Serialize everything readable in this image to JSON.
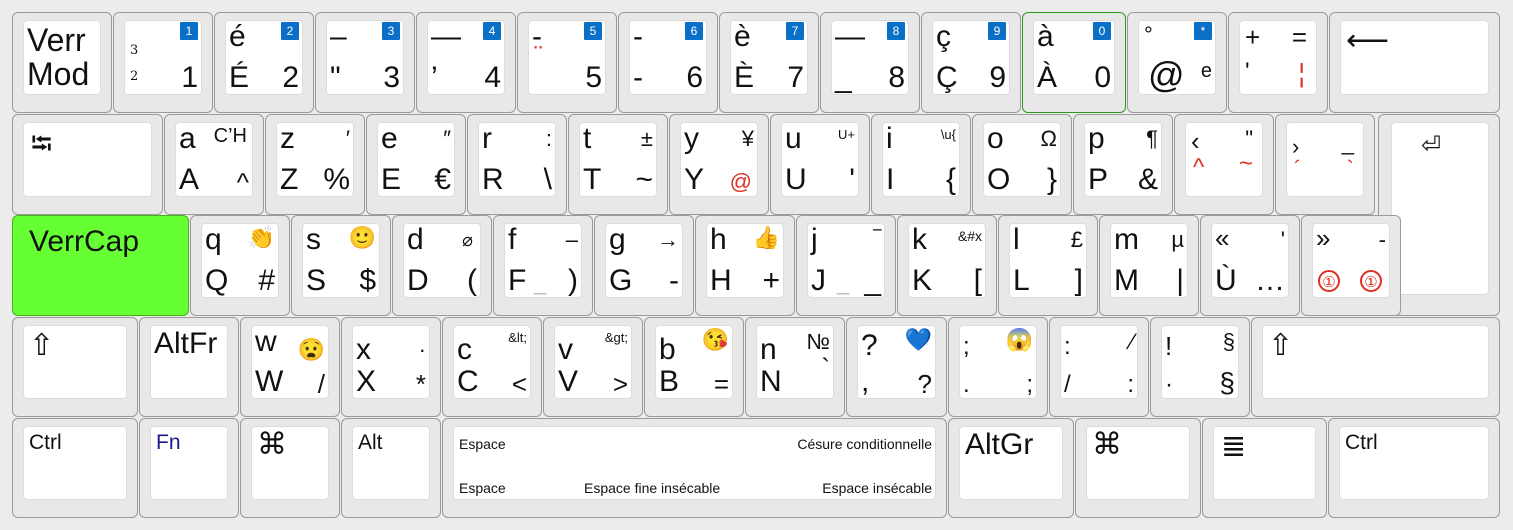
{
  "title": "",
  "row1": [
    {
      "id": "verrmod",
      "top": "Verr",
      "bottom": "Mod"
    },
    {
      "id": "k1",
      "badge": "1",
      "ul": "3",
      "ll": "2",
      "lr": "1"
    },
    {
      "id": "k2",
      "badge": "2",
      "ul": "é",
      "ll": "É",
      "lr": "2"
    },
    {
      "id": "k3",
      "badge": "3",
      "ul": "–",
      "ll": "\"",
      "lr": "3"
    },
    {
      "id": "k4",
      "badge": "4",
      "ul": "—",
      "ll": "’",
      "lr": "4"
    },
    {
      "id": "k5",
      "badge": "5",
      "ul": "-",
      "ll": "̈",
      "lr": "5"
    },
    {
      "id": "k6",
      "badge": "6",
      "ul": "-",
      "ll": "-",
      "lr": "6"
    },
    {
      "id": "k7",
      "badge": "7",
      "ul": "è",
      "ll": "È",
      "lr": "7"
    },
    {
      "id": "k8",
      "badge": "8",
      "ul": "—",
      "ll": "_",
      "lr": "8"
    },
    {
      "id": "k9",
      "badge": "9",
      "ul": "ç",
      "ll": "Ç",
      "lr": "9"
    },
    {
      "id": "k0",
      "badge": "0",
      "ul": "à",
      "ll": "À",
      "lr": "0"
    },
    {
      "id": "kdeg",
      "badge": "*",
      "ul": "°",
      "ll": "@",
      "lr": "e"
    },
    {
      "id": "kplus",
      "ul": "+",
      "ur": "=",
      "ll": "'",
      "lr": "¦"
    },
    {
      "id": "backspace",
      "symbol": "⟵"
    }
  ],
  "row2": [
    {
      "id": "tab",
      "symbol": "⭾"
    },
    {
      "id": "kA",
      "ul": "a",
      "ur": "C’H",
      "ll": "A",
      "lr": "^"
    },
    {
      "id": "kZ",
      "ul": "z",
      "ur": "′",
      "ll": "Z",
      "lr": "%"
    },
    {
      "id": "kE",
      "ul": "e",
      "ur": "″",
      "ll": "E",
      "lr": "€"
    },
    {
      "id": "kR",
      "ul": "r",
      "ur": ":",
      "ll": "R",
      "lr": "\\"
    },
    {
      "id": "kT",
      "ul": "t",
      "ur": "±",
      "ll": "T",
      "lr": "~"
    },
    {
      "id": "kY",
      "ul": "y",
      "ur": "¥",
      "ll": "Y",
      "lr": "@"
    },
    {
      "id": "kU",
      "ul": "u",
      "ur": "U+",
      "ll": "U",
      "lr": "'"
    },
    {
      "id": "kI",
      "ul": "i",
      "ur": "\\u{",
      "ll": "I",
      "lr": "{"
    },
    {
      "id": "kO",
      "ul": "o",
      "ur": "Ω",
      "ll": "O",
      "lr": "}"
    },
    {
      "id": "kP",
      "ul": "p",
      "ur": "¶",
      "ll": "P",
      "lr": "&"
    },
    {
      "id": "kLang",
      "ul": "‹",
      "ur": "\"",
      "ll": "^",
      "lr": "~"
    },
    {
      "id": "kRang",
      "ul": "›",
      "ur": "_",
      "ll": "´",
      "lr": "`"
    },
    {
      "id": "enter",
      "symbol": "⏎"
    }
  ],
  "row3": [
    {
      "id": "verrcap",
      "label": "VerrCap"
    },
    {
      "id": "kQ",
      "ul": "q",
      "ur": "👏",
      "ll": "Q",
      "lr": "#"
    },
    {
      "id": "kS",
      "ul": "s",
      "ur": "🙂",
      "ll": "S",
      "lr": "$"
    },
    {
      "id": "kD",
      "ul": "d",
      "ur": "⌀",
      "ll": "D",
      "lr": "("
    },
    {
      "id": "kF",
      "ul": "f",
      "ur": "–",
      "ll": "F",
      "lr": ")"
    },
    {
      "id": "kG",
      "ul": "g",
      "ur": "→",
      "ll": "G",
      "lr": "-"
    },
    {
      "id": "kH",
      "ul": "h",
      "ur": "👍",
      "ll": "H",
      "lr": "+"
    },
    {
      "id": "kJ",
      "ul": "j",
      "ur": "‾",
      "ll": "J",
      "lr": "_"
    },
    {
      "id": "kK",
      "ul": "k",
      "ur": "&#x",
      "ll": "K",
      "lr": "["
    },
    {
      "id": "kL",
      "ul": "l",
      "ur": "£",
      "ll": "L",
      "lr": "]"
    },
    {
      "id": "kM",
      "ul": "m",
      "ur": "µ",
      "ll": "M",
      "lr": "|"
    },
    {
      "id": "kGuil",
      "ul": "«",
      "ur": "'",
      "ll": "Ù",
      "lr": "…"
    },
    {
      "id": "kGuir",
      "ul": "»",
      "ur": "-",
      "ll": "①",
      "lr": "①"
    }
  ],
  "row4": [
    {
      "id": "lshift",
      "symbol": "⇧"
    },
    {
      "id": "altfr",
      "label": "AltFr"
    },
    {
      "id": "kW",
      "ul": "w",
      "ur": "😧",
      "ll": "W",
      "lr": "/"
    },
    {
      "id": "kX",
      "ul": "x",
      "ur": "·",
      "ll": "X",
      "lr": "*"
    },
    {
      "id": "kC",
      "ul": "c",
      "ur": "&lt;",
      "ll": "C",
      "lr": "<"
    },
    {
      "id": "kV",
      "ul": "v",
      "ur": "&gt;",
      "ll": "V",
      "lr": ">"
    },
    {
      "id": "kB",
      "ul": "b",
      "ur": "😘",
      "ll": "B",
      "lr": "="
    },
    {
      "id": "kN",
      "ul": "n",
      "ur": "№",
      "ll": "N",
      "lr": "`"
    },
    {
      "id": "kQm",
      "ul": "?",
      "ur": "💙",
      "ll": ",",
      "lr": "?"
    },
    {
      "id": "kSemi",
      "ul": ";",
      "ur": "😱",
      "ll": ".",
      "lr": ";"
    },
    {
      "id": "kColon",
      "ul": ":",
      "ur": "⁄",
      "ll": "/",
      "lr": ":"
    },
    {
      "id": "kExcl",
      "ul": "!",
      "ur": "§",
      "ll": "·",
      "lr": "§"
    },
    {
      "id": "rshift",
      "symbol": "⇧"
    }
  ],
  "row5": [
    {
      "id": "lctrl",
      "label": "Ctrl"
    },
    {
      "id": "fn",
      "label": "Fn"
    },
    {
      "id": "lcmd",
      "symbol": "⌘"
    },
    {
      "id": "alt",
      "label": "Alt"
    },
    {
      "id": "space",
      "tl": "Espace",
      "tr": "Césure conditionnelle",
      "bl": "Espace",
      "bm": "Espace fine insécable",
      "br": "Espace insécable"
    },
    {
      "id": "altgr",
      "label": "AltGr"
    },
    {
      "id": "rcmd",
      "symbol": "⌘"
    },
    {
      "id": "menu",
      "symbol": "≣"
    },
    {
      "id": "rctrl",
      "label": "Ctrl"
    }
  ],
  "colors": {
    "accent_blue": "#0a6fc6",
    "caps_green": "#66ff33",
    "dead_key_red": "#e02f22",
    "fn_blue": "#1a1a8c"
  }
}
